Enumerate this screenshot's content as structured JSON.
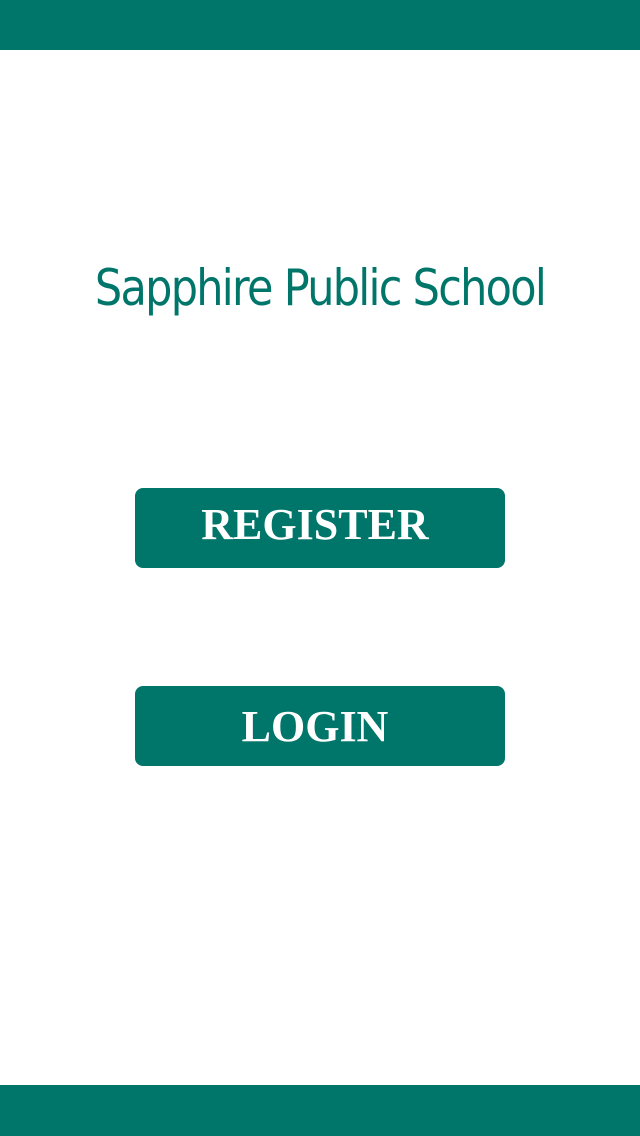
{
  "app": {
    "title": "Sapphire Public School"
  },
  "actions": {
    "register_label": "REGISTER",
    "login_label": "LOGIN"
  },
  "colors": {
    "primary": "#00766b",
    "background": "#ffffff",
    "button_text": "#ffffff"
  }
}
